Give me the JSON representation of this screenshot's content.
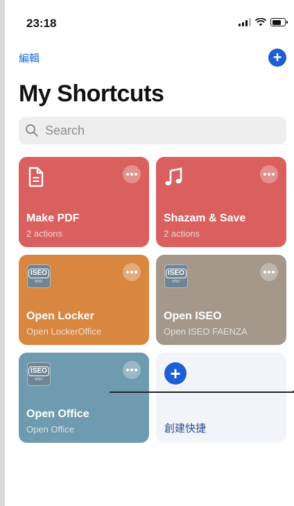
{
  "status_bar": {
    "time": "23:18"
  },
  "nav": {
    "edit_label": "編輯",
    "add_label": "+"
  },
  "title": "My Shortcuts",
  "search": {
    "placeholder": "Search"
  },
  "shortcuts": [
    {
      "name": "Make PDF",
      "subtitle": "2 actions",
      "color": "#d9605f",
      "icon": "document-icon"
    },
    {
      "name": "Shazam & Save",
      "subtitle": "2 actions",
      "color": "#d9605f",
      "icon": "music-note-icon"
    },
    {
      "name": "Open Locker",
      "subtitle": "Open LockerOffice",
      "color": "#d98641",
      "icon": "iseo-app-icon"
    },
    {
      "name": "Open ISEO",
      "subtitle": "Open ISEO FAENZA",
      "color": "#a5988b",
      "icon": "iseo-app-icon"
    },
    {
      "name": "Open Office",
      "subtitle": "Open Office",
      "color": "#6f9bb0",
      "icon": "iseo-app-icon"
    }
  ],
  "create": {
    "label": "創建快捷",
    "plus": "+"
  },
  "iseo_badge": {
    "text": "ISEO",
    "sub": "MNU"
  }
}
